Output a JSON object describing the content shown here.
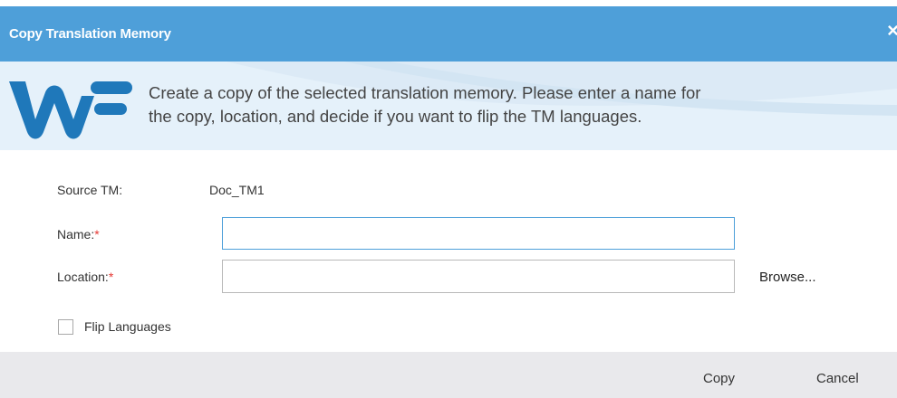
{
  "dialog": {
    "title": "Copy Translation Memory",
    "close_glyph": "×",
    "description": "Create a copy of the selected translation memory. Please enter a name for\nthe copy, location, and decide if you want to flip the TM languages."
  },
  "form": {
    "source_tm_label": "Source TM:",
    "source_tm_value": "Doc_TM1",
    "name_label": "Name:",
    "name_value": "",
    "location_label": "Location:",
    "location_value": "",
    "required_marker": "*",
    "browse_label": "Browse...",
    "flip_languages_label": "Flip Languages",
    "flip_languages_checked": false
  },
  "footer": {
    "copy_label": "Copy",
    "cancel_label": "Cancel"
  },
  "colors": {
    "titlebar": "#4e9fd9",
    "banner": "#e5f1fa",
    "logo": "#1f78ba",
    "required": "#e53935",
    "footer": "#e9e9ec"
  },
  "icons": {
    "logo": "wordfast-logo",
    "close": "close-icon"
  }
}
